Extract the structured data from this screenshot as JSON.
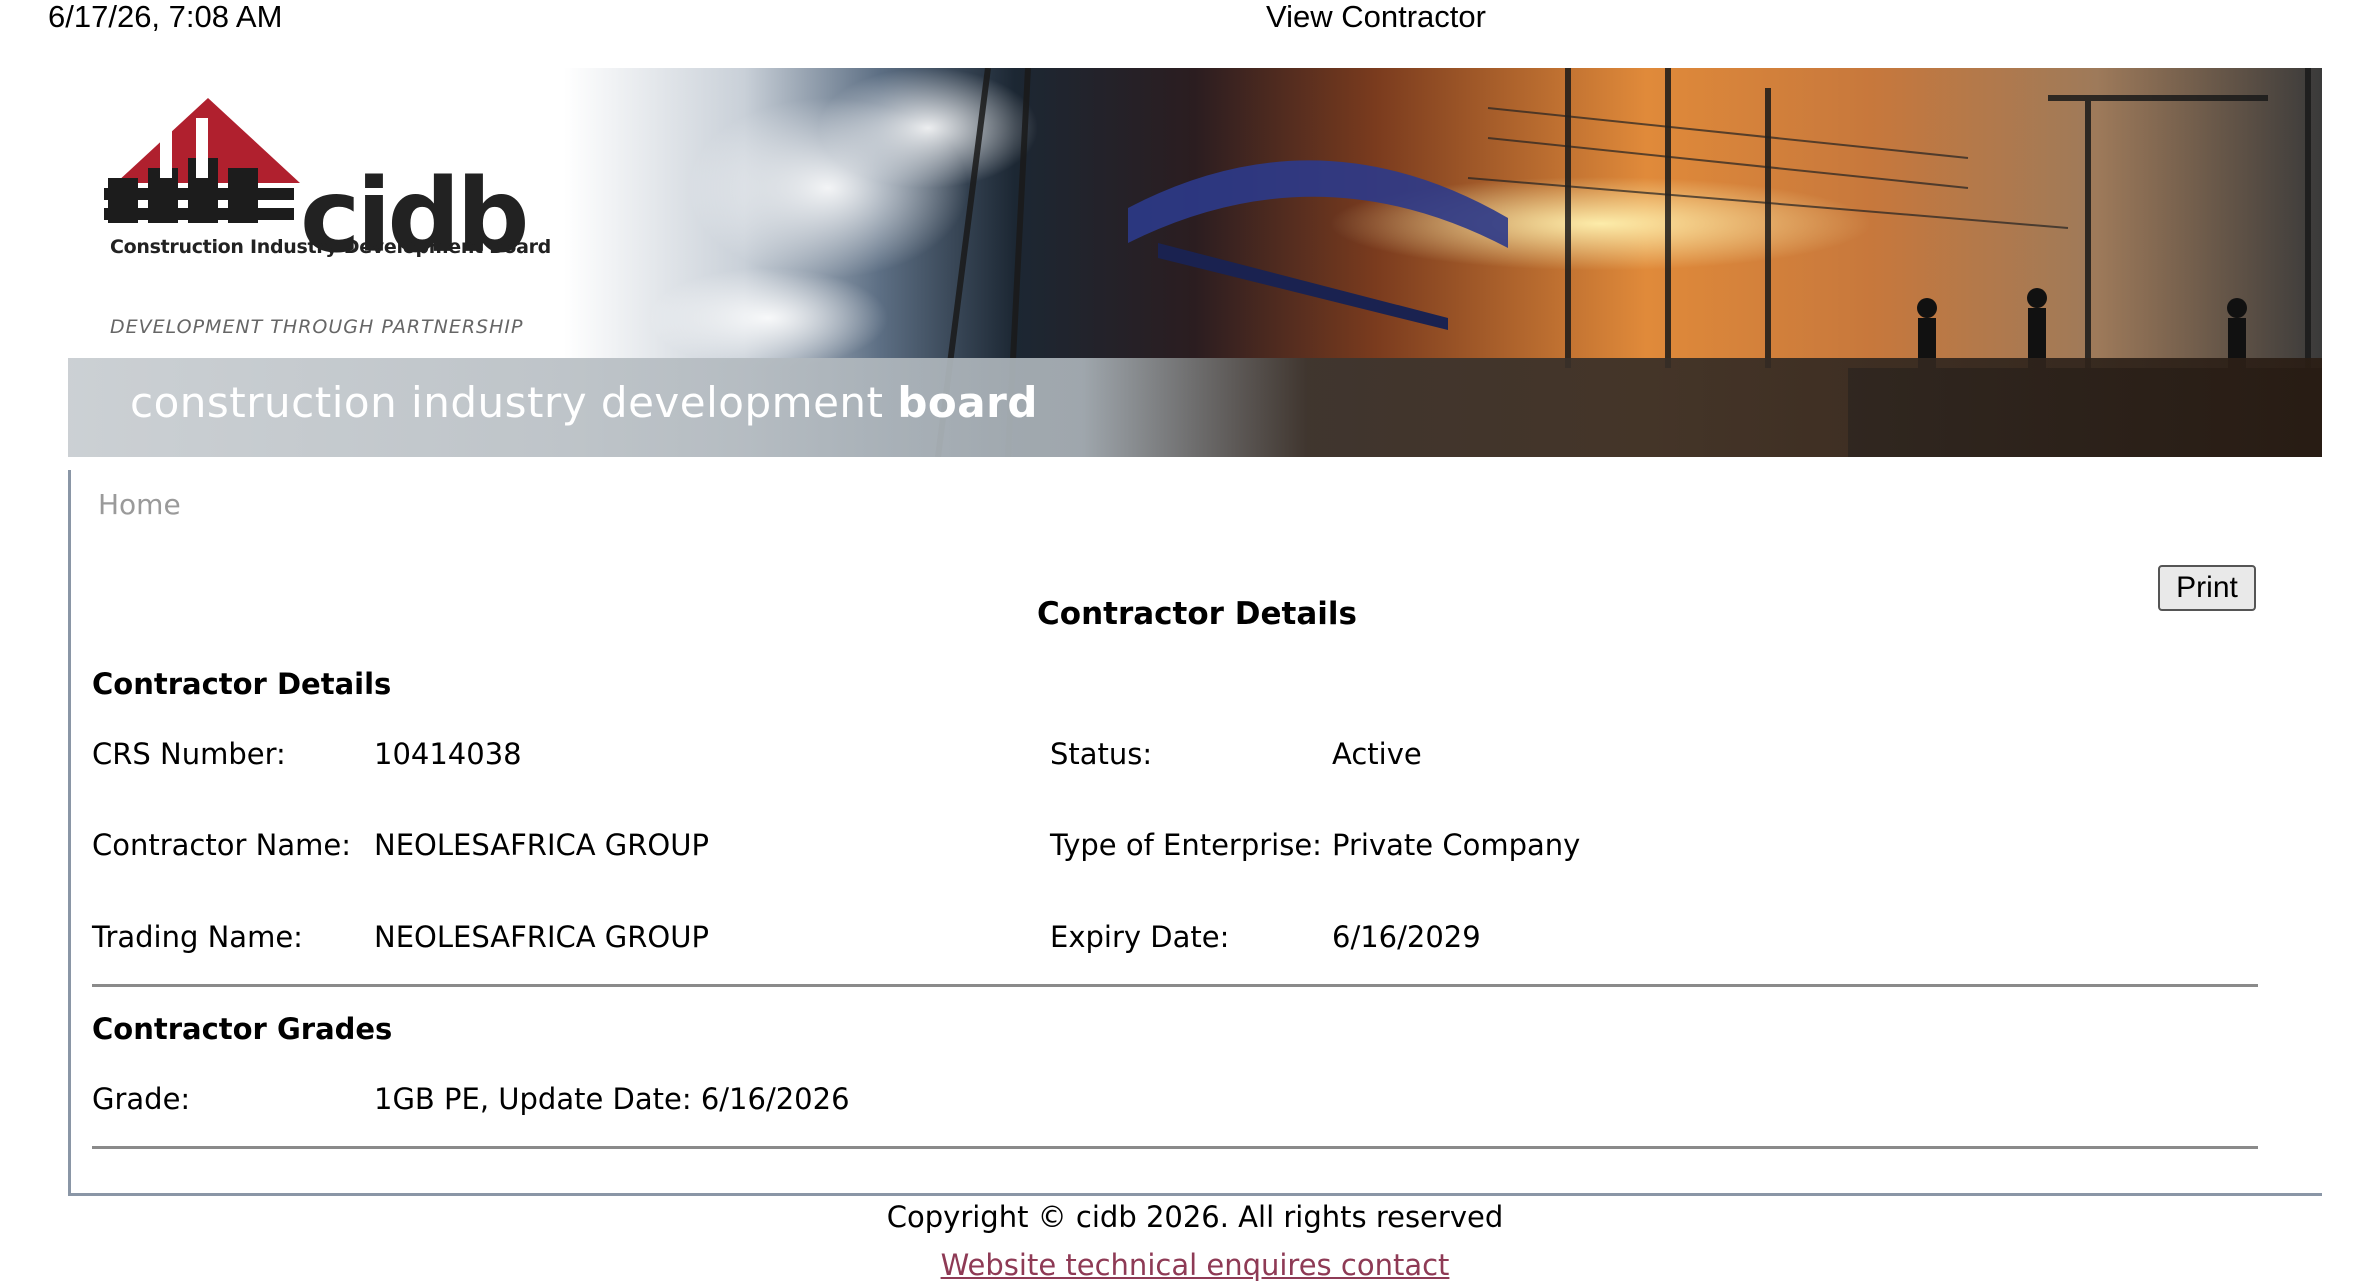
{
  "print_header": {
    "datetime": "6/17/26, 7:08 AM",
    "doc_title": "View Contractor"
  },
  "banner": {
    "logo_word": "cidb",
    "logo_subtitle": "Construction Industry Development Board",
    "tagline": "DEVELOPMENT THROUGH PARTNERSHIP",
    "strip_text_regular": "construction industry development",
    "strip_text_bold": "board"
  },
  "nav": {
    "home_label": "Home"
  },
  "toolbar": {
    "print_label": "Print"
  },
  "page": {
    "heading": "Contractor Details"
  },
  "details": {
    "section_title": "Contractor Details",
    "left": [
      {
        "label": "CRS Number:",
        "value": "10414038"
      },
      {
        "label": "Contractor Name:",
        "value": "NEOLESAFRICA GROUP"
      },
      {
        "label": "Trading Name:",
        "value": "NEOLESAFRICA GROUP"
      }
    ],
    "right": [
      {
        "label": "Status:",
        "value": "Active"
      },
      {
        "label": "Type of Enterprise:",
        "value": "Private Company"
      },
      {
        "label": "Expiry Date:",
        "value": "6/16/2029"
      }
    ]
  },
  "grades": {
    "section_title": "Contractor Grades",
    "label": "Grade:",
    "value": "1GB PE, Update Date: 6/16/2026"
  },
  "footer": {
    "copyright": "Copyright © cidb 2026. All rights reserved",
    "link_label": "Website technical enquires contact"
  },
  "colors": {
    "frame_border": "#8a96a6",
    "link": "#8e3a55",
    "logo_red": "#b0202e",
    "nav_text": "#9a9a9a"
  }
}
